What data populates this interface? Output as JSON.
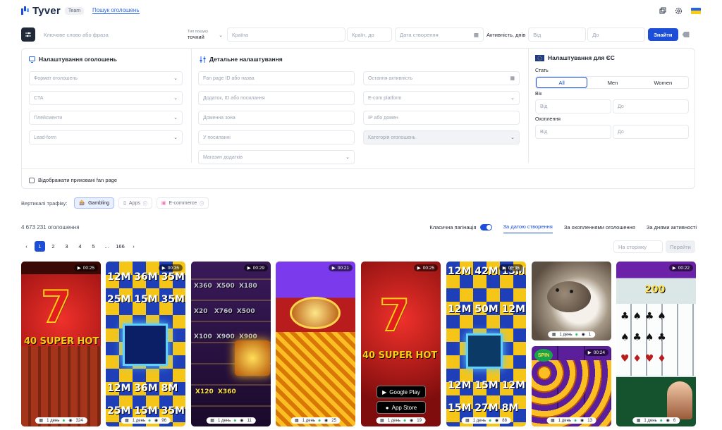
{
  "header": {
    "logo_text": "Tyver",
    "team_badge": "Team",
    "nav_link": "Пошук оголошень"
  },
  "search": {
    "keyword_placeholder": "Ключове слово або фраза",
    "search_type_label": "Тип пошуку",
    "search_type_value": "точний",
    "country_placeholder": "Країна",
    "country_to_placeholder": "Країн, до",
    "created_date_placeholder": "Дата створення",
    "activity_label": "Активність, днів",
    "from_placeholder": "Від",
    "to_placeholder": "До",
    "find_button": "Знайти"
  },
  "ad_settings": {
    "title": "Налаштування оголошень",
    "fields": [
      "Формат оголошень",
      "CTA",
      "Плейсменти",
      "Lead-form"
    ]
  },
  "detailed_settings": {
    "title": "Детальне налаштування",
    "left_fields": [
      "Fan page ID або назва",
      "Додаток, ID або посилання",
      "Доменна зона",
      "У посиланні",
      "Магазин додатків"
    ],
    "right_fields": [
      "Остання активність",
      "E-com platform",
      "IP або домен",
      "Категорія оголошень"
    ]
  },
  "eu_settings": {
    "title": "Налаштування для ЄС",
    "gender_label": "Стать",
    "gender_options": [
      "All",
      "Men",
      "Women"
    ],
    "age_label": "Вік",
    "reach_label": "Охоплення",
    "from": "Від",
    "to": "До"
  },
  "show_hidden_label": "Відображати приховані fan page",
  "verticals": {
    "label": "Вертикалі трафіку:",
    "items": [
      "Gambling",
      "Apps",
      "E-commerce"
    ]
  },
  "results": {
    "count": "4 673 231 оголошення",
    "classic_pagination": "Класична пагінація",
    "sort_tabs": [
      "За датою створення",
      "За охопленнями оголошення",
      "За днями активності"
    ]
  },
  "pagination": {
    "pages": [
      "1",
      "2",
      "3",
      "4",
      "5",
      "...",
      "166"
    ],
    "active_index": 0,
    "goto_placeholder": "На сторінку",
    "goto_button": "Перейти"
  },
  "cards": [
    {
      "duration": "00:25",
      "days": "1 день",
      "count": "324",
      "headline": "40 SUPER HOT",
      "kind": "hot"
    },
    {
      "duration": "00:35",
      "days": "1 день",
      "count": "96",
      "kind": "grid"
    },
    {
      "duration": "00:29",
      "days": "1 день",
      "count": "11",
      "kind": "slot"
    },
    {
      "duration": "00:21",
      "days": "1 день",
      "count": "25",
      "kind": "coin"
    },
    {
      "duration": "00:25",
      "days": "1 день",
      "count": "19",
      "headline": "40 SUPER HOT",
      "store1": "Google Play",
      "store2": "App Store",
      "kind": "hot"
    },
    {
      "duration": "00:35",
      "days": "1 день",
      "count": "88",
      "kind": "grid"
    },
    {
      "duration": "",
      "days": "1 день",
      "count": "1",
      "kind": "cat"
    },
    {
      "duration": "00:24",
      "days": "1 день",
      "count": "13",
      "kind": "spin"
    },
    {
      "duration": "00:22",
      "days": "1 день",
      "count": "6",
      "headline": "200",
      "kind": "cards"
    }
  ],
  "colors": {
    "accent": "#1d4ed8",
    "dark": "#1f2937"
  }
}
